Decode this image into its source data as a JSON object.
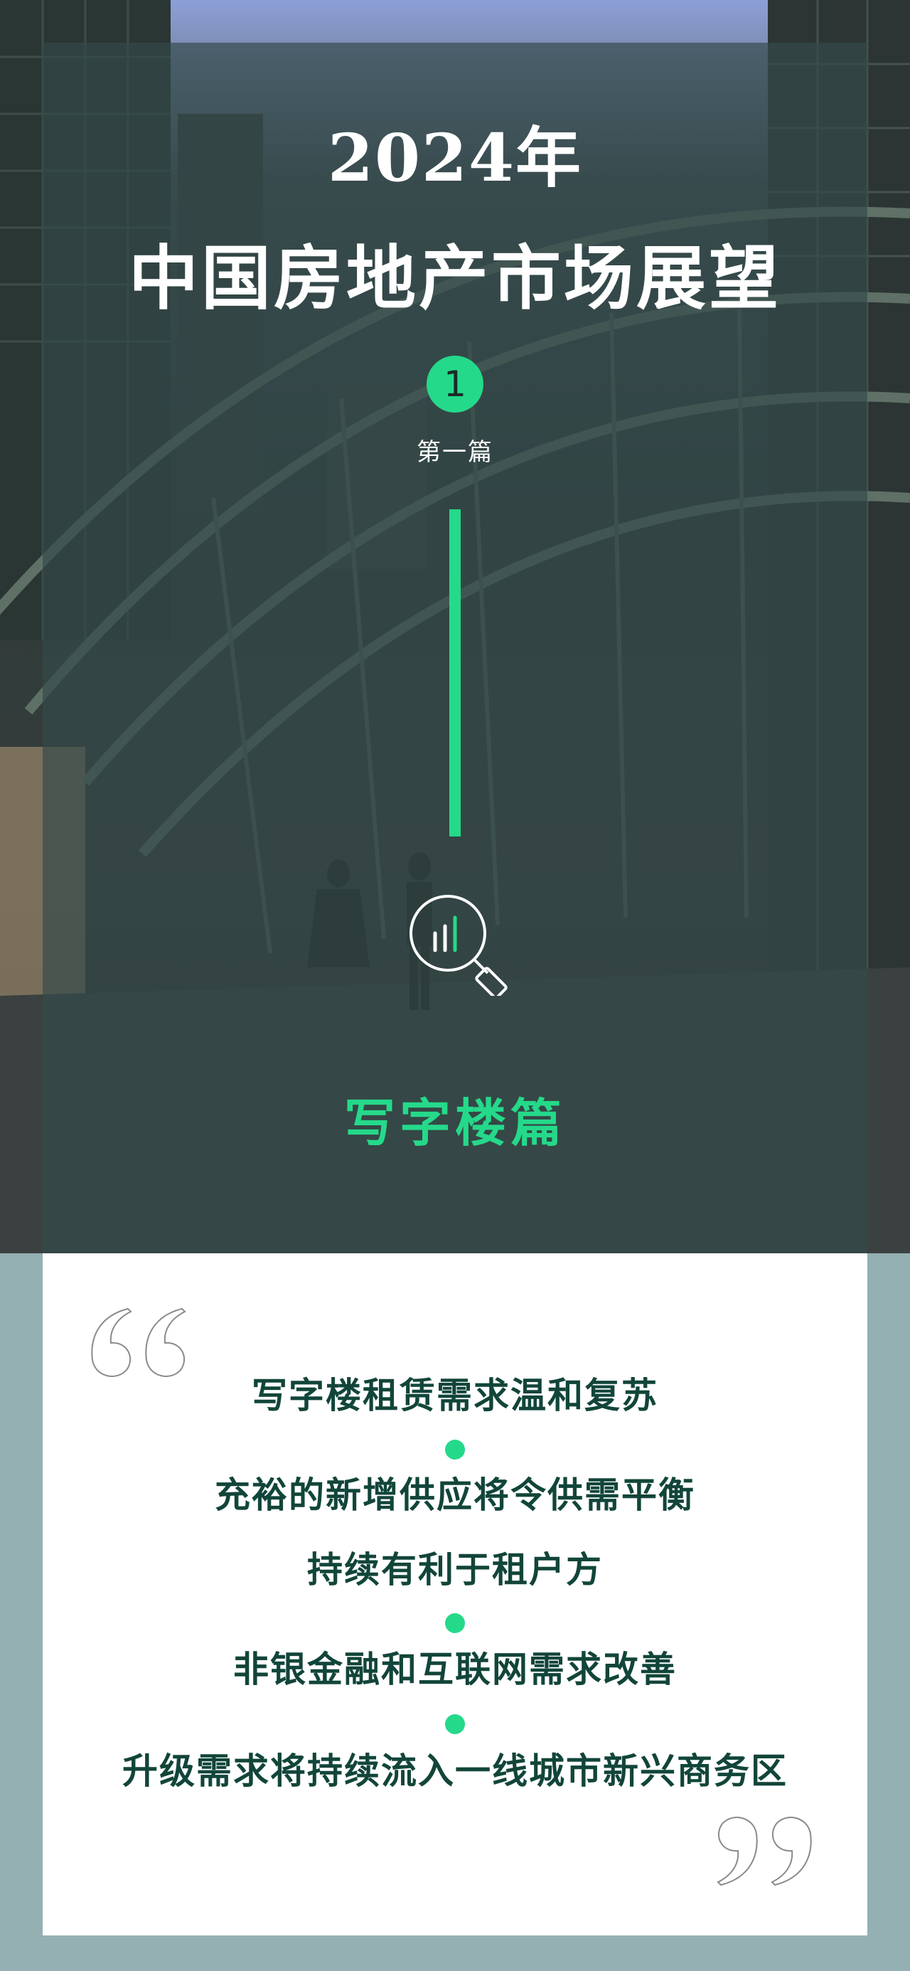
{
  "header": {
    "year_title": "2024年",
    "main_title": "中国房地产市场展望",
    "part_number": "1",
    "part_label": "第一篇"
  },
  "section": {
    "title": "写字楼篇"
  },
  "key_points": [
    "写字楼租赁需求温和复苏",
    "充裕的新增供应将令供需平衡",
    "持续有利于租户方",
    "非银金融和互联网需求改善",
    "升级需求将持续流入一线城市新兴商务区"
  ],
  "colors": {
    "accent_green": "#25d98a",
    "text_dark_green": "#12453a",
    "panel_overlay": "#344a4a",
    "page_bg": "#95b0b2"
  },
  "icons": {
    "chart_search": "chart-search-icon",
    "quote_open": "quote-open-icon",
    "quote_close": "quote-close-icon"
  }
}
